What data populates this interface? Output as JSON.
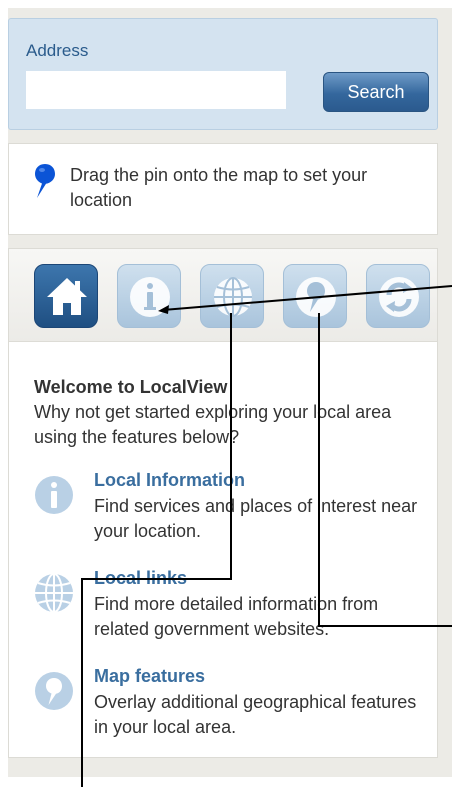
{
  "address": {
    "label": "Address",
    "input_value": "",
    "input_placeholder": "",
    "search_label": "Search"
  },
  "pin_hint": {
    "text": "Drag the pin onto the map to set your location"
  },
  "toolbar": {
    "buttons": [
      {
        "icon": "home-icon",
        "active": true
      },
      {
        "icon": "info-icon",
        "active": false
      },
      {
        "icon": "globe-icon",
        "active": false
      },
      {
        "icon": "map-pin-icon",
        "active": false
      },
      {
        "icon": "refresh-icon",
        "active": false
      }
    ]
  },
  "welcome": {
    "title": "Welcome to LocalView",
    "text": "Why not get started exploring your local area using the features below?"
  },
  "features": [
    {
      "icon": "info-icon",
      "title": "Local Information",
      "description": "Find services and places of interest near your location."
    },
    {
      "icon": "globe-icon",
      "title": "Local links",
      "description": "Find more detailed information from related government websites."
    },
    {
      "icon": "map-pin-icon",
      "title": "Map features",
      "description": "Overlay additional geographical features in your local area."
    }
  ],
  "colors": {
    "accent_blue": "#2b5a8e",
    "link_blue": "#3a6e9f",
    "pin_blue": "#0b54d6",
    "panel_bg": "#ecebe6"
  }
}
